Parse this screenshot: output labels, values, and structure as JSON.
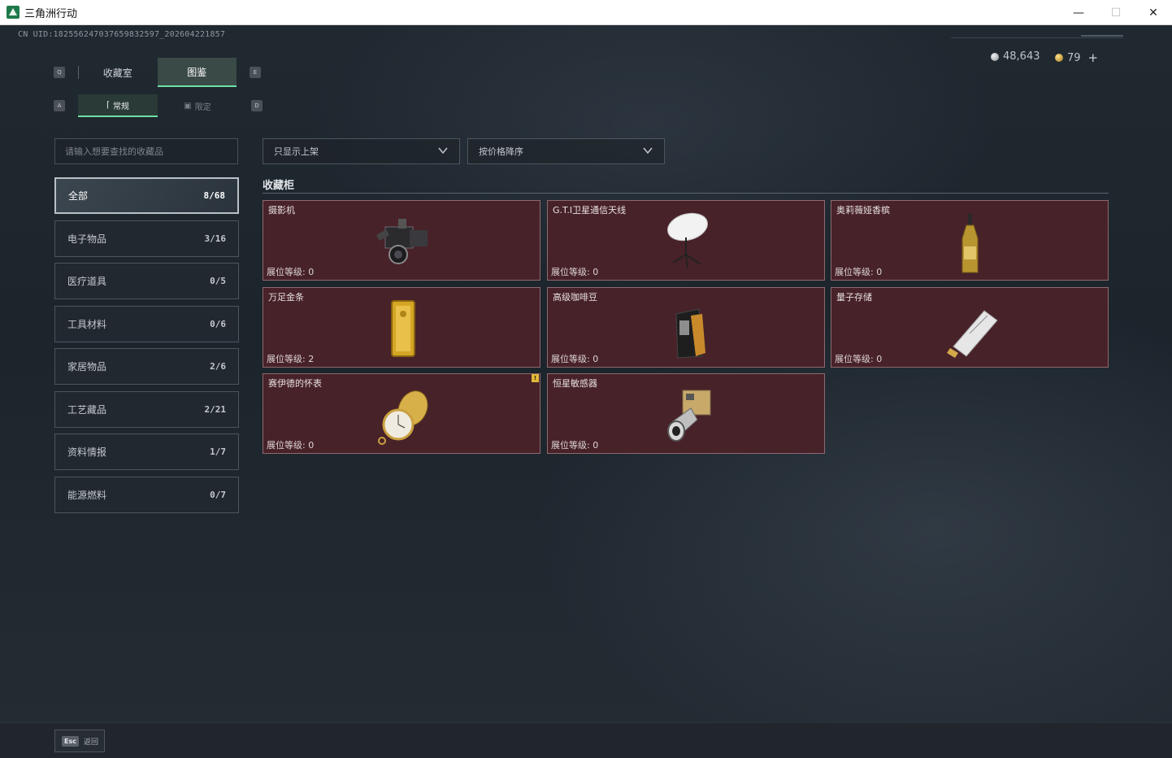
{
  "window": {
    "title": "三角洲行动"
  },
  "header": {
    "uid": "CN UID:1825562470376598325​97_202604221857",
    "currency": [
      {
        "icon": "silver-coin-icon",
        "value": "48,643"
      },
      {
        "icon": "gold-coin-icon",
        "value": "79"
      }
    ],
    "add_label": "+"
  },
  "tabs": {
    "main": [
      {
        "label": "收藏室",
        "active": false
      },
      {
        "label": "图鉴",
        "active": true
      }
    ],
    "sub": [
      {
        "label": "常规",
        "active": true
      },
      {
        "label": "限定",
        "active": false
      }
    ],
    "keys": {
      "prev_main": "Q",
      "next_main": "E",
      "prev_sub": "A",
      "next_sub": "D"
    }
  },
  "search": {
    "placeholder": "请输入想要查找的收藏品"
  },
  "categories": [
    {
      "label": "全部",
      "count": "8/68",
      "active": true
    },
    {
      "label": "电子物品",
      "count": "3/16",
      "active": false
    },
    {
      "label": "医疗道具",
      "count": "0/5",
      "active": false
    },
    {
      "label": "工具材料",
      "count": "0/6",
      "active": false
    },
    {
      "label": "家居物品",
      "count": "2/6",
      "active": false
    },
    {
      "label": "工艺藏品",
      "count": "2/21",
      "active": false
    },
    {
      "label": "资料情报",
      "count": "1/7",
      "active": false
    },
    {
      "label": "能源燃料",
      "count": "0/7",
      "active": false
    }
  ],
  "filters": {
    "shelf": "只显示上架",
    "sort": "按价格降序"
  },
  "cabinet": {
    "title": "收藏柜",
    "level_prefix": "展位等级: ",
    "items": [
      {
        "name": "摄影机",
        "level": "0",
        "icon": "camera-icon"
      },
      {
        "name": "G.T.I卫星通信天线",
        "level": "0",
        "icon": "satellite-dish-icon"
      },
      {
        "name": "奥莉薇娅香槟",
        "level": "0",
        "icon": "champagne-bottle-icon"
      },
      {
        "name": "万足金条",
        "level": "2",
        "icon": "gold-bar-icon"
      },
      {
        "name": "高级咖啡豆",
        "level": "0",
        "icon": "coffee-bag-icon"
      },
      {
        "name": "量子存储",
        "level": "0",
        "icon": "quantum-storage-icon"
      },
      {
        "name": "赛伊德的怀表",
        "level": "0",
        "icon": "pocket-watch-icon",
        "new_badge": "!"
      },
      {
        "name": "恒星敏感器",
        "level": "0",
        "icon": "star-sensor-icon"
      }
    ]
  },
  "footer": {
    "esc_key": "Esc",
    "esc_label": "返回"
  },
  "colors": {
    "accent": "#6ee0a5",
    "card_bg": "#482229",
    "card_border": "#8d6a6f"
  }
}
